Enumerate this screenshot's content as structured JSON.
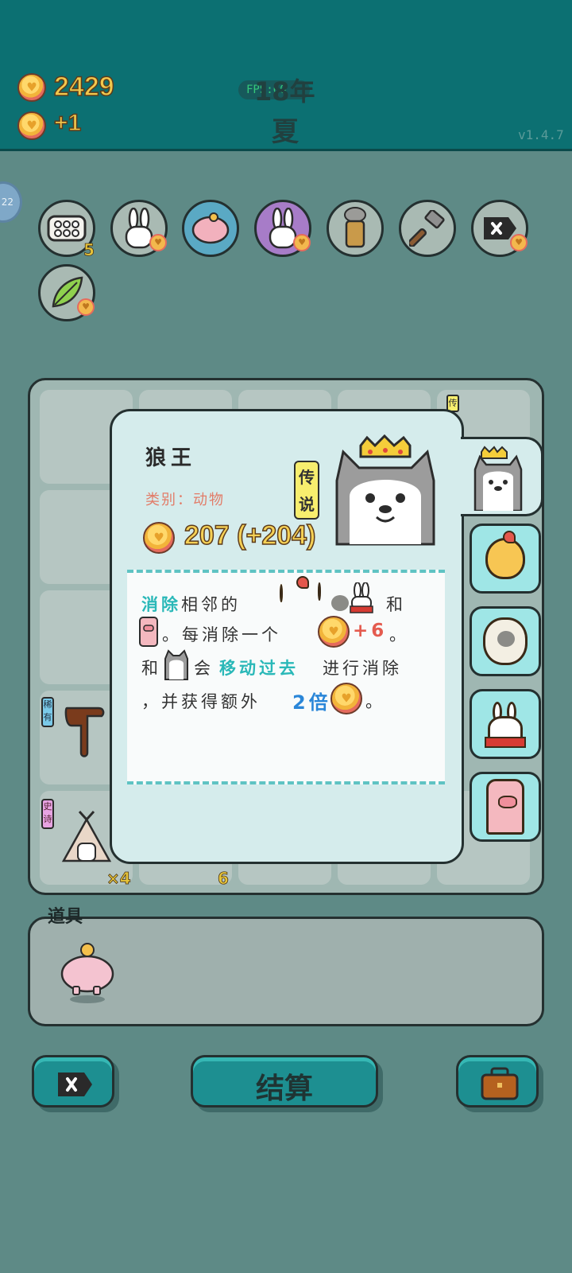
{
  "header": {
    "coins": "2429",
    "income": "+1",
    "fps_label": "FPS:60",
    "year": "18年",
    "season": "夏",
    "version": "v1.4.7"
  },
  "side_badge": "22",
  "relics": [
    {
      "name": "egg-tray",
      "count": "5"
    },
    {
      "name": "rabbit"
    },
    {
      "name": "piggy-bank"
    },
    {
      "name": "rabbit-purple"
    },
    {
      "name": "bubble-tea"
    },
    {
      "name": "hammer"
    },
    {
      "name": "delete"
    },
    {
      "name": "leaf"
    }
  ],
  "board": {
    "cell_labels": [
      "稀有",
      "史诗",
      "传"
    ],
    "multiplier": "×4",
    "count": "6"
  },
  "popup": {
    "name": "狼王",
    "category": "类别：动物",
    "rarity": "传说",
    "value": "207 (+204)",
    "desc": {
      "line1_kw": "消除",
      "line1_text": "相邻的",
      "line1_and": "和",
      "line2_text": "。每消除一个",
      "line2_bonus": "+6",
      "line2_end": "。",
      "line3_and": "和",
      "line3_text": "会",
      "line3_kw": "移动过去",
      "line3_end": "进行消除",
      "line4_start": "，并获得额外",
      "line4_kw": "2倍",
      "line4_end": "。"
    }
  },
  "side_tabs": [
    "wolf-king",
    "chick",
    "sheep",
    "rabbit",
    "pig"
  ],
  "items": {
    "label": "道具",
    "item": "piggy-bank"
  },
  "buttons": {
    "settle": "结算"
  },
  "colors": {
    "header_bg": "#0c7072",
    "page_bg": "#5e8a86",
    "accent": "#1d8f91",
    "coin_text": "#f1c84d",
    "rarity_bg": "#f8ee6e"
  }
}
